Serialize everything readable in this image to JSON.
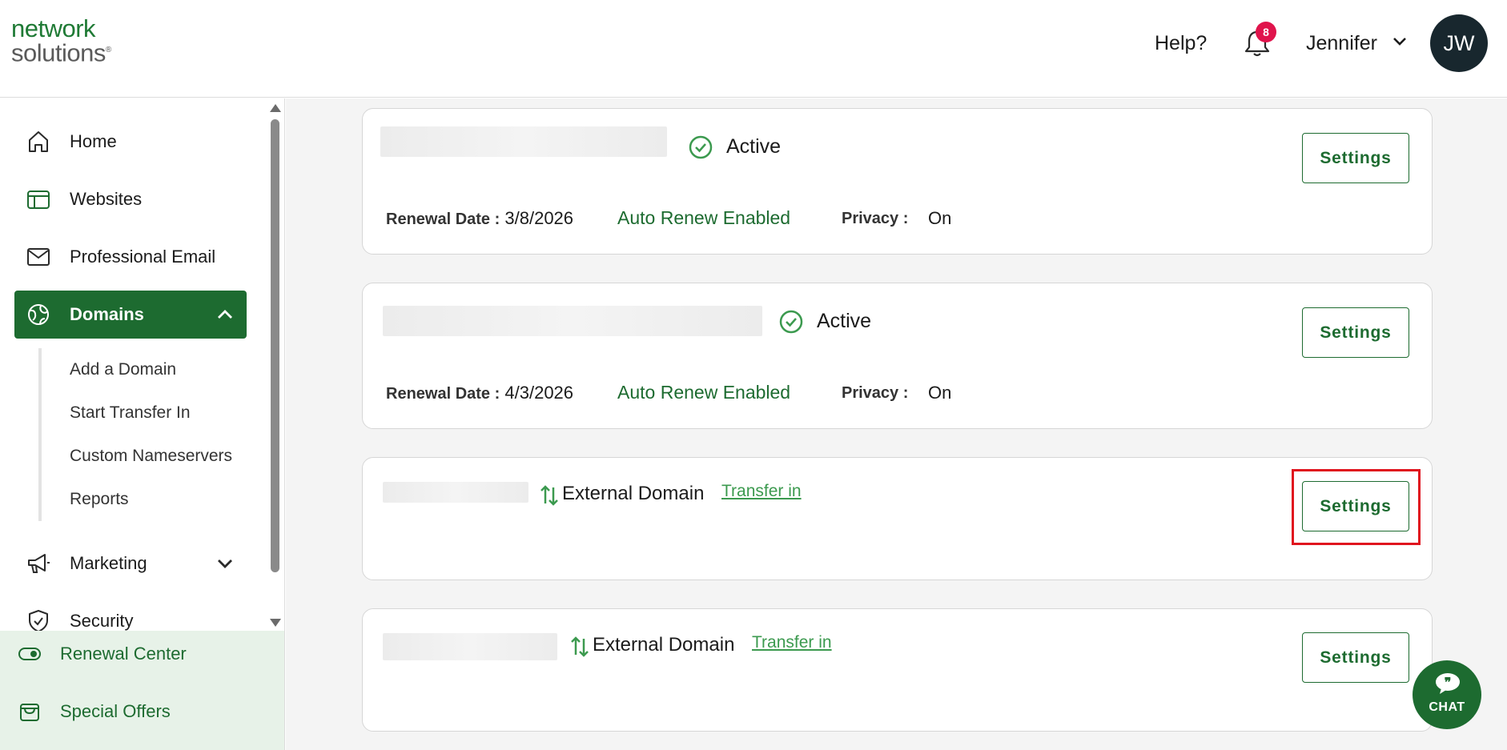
{
  "brand": {
    "line1": "network",
    "line2": "solutions",
    "reg": "®"
  },
  "header": {
    "help": "Help?",
    "notification_count": "8",
    "user_name": "Jennifer",
    "avatar_initials": "JW"
  },
  "sidebar": {
    "items": [
      {
        "label": "Home",
        "icon": "home-icon"
      },
      {
        "label": "Websites",
        "icon": "websites-icon"
      },
      {
        "label": "Professional Email",
        "icon": "mail-icon"
      },
      {
        "label": "Domains",
        "icon": "globe-icon",
        "active": true,
        "expanded": true
      },
      {
        "label": "Marketing",
        "icon": "megaphone-icon"
      },
      {
        "label": "Security",
        "icon": "shield-icon"
      }
    ],
    "domains_sub": [
      "Add a Domain",
      "Start Transfer In",
      "Custom Nameservers",
      "Reports"
    ],
    "bottom": [
      {
        "label": "Renewal Center",
        "icon": "toggle-icon"
      },
      {
        "label": "Special Offers",
        "icon": "gift-icon"
      }
    ]
  },
  "domains": [
    {
      "status": "Active",
      "renewal_label": "Renewal Date :",
      "renewal_date": "3/8/2026",
      "auto_renew": "Auto Renew Enabled",
      "privacy_label": "Privacy :",
      "privacy_value": "On",
      "settings": "Settings"
    },
    {
      "status": "Active",
      "renewal_label": "Renewal Date :",
      "renewal_date": "4/3/2026",
      "auto_renew": "Auto Renew Enabled",
      "privacy_label": "Privacy :",
      "privacy_value": "On",
      "settings": "Settings"
    },
    {
      "status": "External Domain",
      "transfer": "Transfer in",
      "settings": "Settings"
    },
    {
      "status": "External Domain",
      "transfer": "Transfer in",
      "settings": "Settings"
    }
  ],
  "chat": {
    "label": "CHAT"
  },
  "colors": {
    "brand_green": "#1d6b30",
    "accent_green": "#3c9a4f",
    "badge_red": "#e0144c",
    "highlight_red": "#e0141e",
    "avatar_bg": "#18272e"
  }
}
